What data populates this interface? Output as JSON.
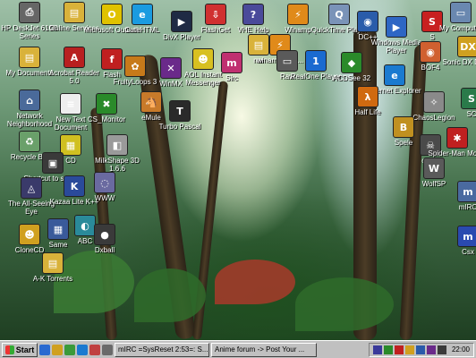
{
  "desktop_icons": [
    {
      "label": "HP DeskJet 610C Series",
      "glyph": "⎙",
      "color": "#666666",
      "icon": "printer-icon"
    },
    {
      "label": "Online Services",
      "glyph": "▤",
      "color": "#d9b23a",
      "icon": "folder-icon"
    },
    {
      "label": "Microsoft Outlook",
      "glyph": "O",
      "color": "#e0c200",
      "icon": "outlook-icon"
    },
    {
      "label": "CuteHTML",
      "glyph": "e",
      "color": "#1a9be0",
      "icon": "cutehtml-icon"
    },
    {
      "label": "DivX Player",
      "glyph": "▶",
      "color": "#1f2a44",
      "icon": "divx-player-icon"
    },
    {
      "label": "FlashGet",
      "glyph": "⇩",
      "color": "#d03030",
      "icon": "flashget-icon"
    },
    {
      "label": "VHE Help",
      "glyph": "?",
      "color": "#4a4a9a",
      "icon": "help-icon"
    },
    {
      "label": "Winamp",
      "glyph": "⚡",
      "color": "#e08a1a",
      "icon": "winamp-icon"
    },
    {
      "label": "QuickTime Player",
      "glyph": "Q",
      "color": "#7a93b8",
      "icon": "quicktime-icon"
    },
    {
      "label": "DC++",
      "glyph": "◉",
      "color": "#2a5caa",
      "icon": "dcpp-icon"
    },
    {
      "label": "Windows Media Player",
      "glyph": "▶",
      "color": "#2e66c4",
      "icon": "media-player-icon"
    },
    {
      "label": "S",
      "glyph": "S",
      "color": "#c82020",
      "icon": "s-icon"
    },
    {
      "label": "My Computer",
      "glyph": "▭",
      "color": "#6a88b0",
      "icon": "computer-icon"
    },
    {
      "label": "My Documents",
      "glyph": "▤",
      "color": "#d9b23a",
      "icon": "documents-icon"
    },
    {
      "label": "Acrobat Reader 5.0",
      "glyph": "A",
      "color": "#b82020",
      "icon": "acrobat-icon"
    },
    {
      "label": "Flash",
      "glyph": "f",
      "color": "#c02020",
      "icon": "flash-icon"
    },
    {
      "label": "FruityLoops 3",
      "glyph": "✿",
      "color": "#c77a1a",
      "icon": "fruityloops-icon"
    },
    {
      "label": "WinMX",
      "glyph": "✕",
      "color": "#6a2a8a",
      "icon": "winmx-icon"
    },
    {
      "label": "AOL Instant Messenger",
      "glyph": "☻",
      "color": "#d8c020",
      "icon": "aim-icon"
    },
    {
      "label": "Sirc",
      "glyph": "m",
      "color": "#c03070",
      "icon": "sirc-icon"
    },
    {
      "label": "nar",
      "glyph": "▤",
      "color": "#d9b23a",
      "icon": "folder-icon"
    },
    {
      "label": "winamp50be...",
      "glyph": "⚡",
      "color": "#e08a1a",
      "icon": "winamp-installer-icon"
    },
    {
      "label": "Raw",
      "glyph": "▭",
      "color": "#5a5a5a",
      "icon": "raw-icon"
    },
    {
      "label": "RealOne Player",
      "glyph": "1",
      "color": "#1a6ad0",
      "icon": "realone-icon"
    },
    {
      "label": "ACDSee 32",
      "glyph": "◆",
      "color": "#2a8a2a",
      "icon": "acdsee-icon"
    },
    {
      "label": "Internet Explorer",
      "glyph": "e",
      "color": "#1a7ad0",
      "icon": "ie-icon"
    },
    {
      "label": "BOF4",
      "glyph": "◉",
      "color": "#d06030",
      "icon": "bof4-icon"
    },
    {
      "label": "Sonic DX Demo",
      "glyph": "DX",
      "color": "#d0a020",
      "icon": "sonic-icon"
    },
    {
      "label": "Network Neighborhood",
      "glyph": "⌂",
      "color": "#4a6a9a",
      "icon": "network-icon"
    },
    {
      "label": "New Text Document",
      "glyph": "≡",
      "color": "#eeeeee",
      "icon": "text-document-icon"
    },
    {
      "label": "CS_Monitor",
      "glyph": "✖",
      "color": "#2a8a2a",
      "icon": "monitor-icon"
    },
    {
      "label": "eMule",
      "glyph": "🐴",
      "color": "#c87a2a",
      "icon": "emule-icon"
    },
    {
      "label": "Turbo Pascal",
      "glyph": "T",
      "color": "#2a2a2a",
      "icon": "turbo-pascal-icon"
    },
    {
      "label": "Half Life",
      "glyph": "λ",
      "color": "#d06a10",
      "icon": "half-life-icon"
    },
    {
      "label": "ChaosLegion",
      "glyph": "✧",
      "color": "#8a8a8a",
      "icon": "chaoslegion-icon"
    },
    {
      "label": "SC",
      "glyph": "S",
      "color": "#2a7a4a",
      "icon": "sc-icon"
    },
    {
      "label": "Recycle Bin",
      "glyph": "♻",
      "color": "#6aa06a",
      "icon": "recycle-bin-icon"
    },
    {
      "label": "CD",
      "glyph": "▦",
      "color": "#d0c020",
      "icon": "cd-icon"
    },
    {
      "label": "MilkShape 3D 1.6.6",
      "glyph": "◧",
      "color": "#9a9a9a",
      "icon": "milkshape-icon"
    },
    {
      "label": "Spele",
      "glyph": "B",
      "color": "#c09020",
      "icon": "spele-icon"
    },
    {
      "label": "czero",
      "glyph": "☠",
      "color": "#4a4a4a",
      "icon": "czero-icon"
    },
    {
      "label": "Spider-Man Movie",
      "glyph": "✱",
      "color": "#c02020",
      "icon": "spiderman-icon"
    },
    {
      "label": "Shortcut to stinger",
      "glyph": "▣",
      "color": "#3a3a3a",
      "icon": "stinger-icon"
    },
    {
      "label": "WolfSP",
      "glyph": "W",
      "color": "#5a5a5a",
      "icon": "wolfsp-icon"
    },
    {
      "label": "The All-Seeing Eye",
      "glyph": "◬",
      "color": "#3a3a6a",
      "icon": "all-seeing-eye-icon"
    },
    {
      "label": "Kazaa Lite K++",
      "glyph": "K",
      "color": "#2a4a9a",
      "icon": "kazaa-icon"
    },
    {
      "label": "WWW",
      "glyph": "◌",
      "color": "#6a6aa0",
      "icon": "www-icon"
    },
    {
      "label": "mIRC",
      "glyph": "m",
      "color": "#4a6aa0",
      "icon": "mirc-icon"
    },
    {
      "label": "CloneCD",
      "glyph": "☻",
      "color": "#d0a020",
      "icon": "clonecd-icon"
    },
    {
      "label": "Same",
      "glyph": "▦",
      "color": "#3a5a9a",
      "icon": "same-icon"
    },
    {
      "label": "ABC",
      "glyph": "◐",
      "color": "#2a8a9a",
      "icon": "abc-icon"
    },
    {
      "label": "Dxball",
      "glyph": "●",
      "color": "#3a3a3a",
      "icon": "dxball-icon"
    },
    {
      "label": "Csx",
      "glyph": "m",
      "color": "#2a4ab0",
      "icon": "csx-icon"
    },
    {
      "label": "A-K Torrents",
      "glyph": "▤",
      "color": "#d9b23a",
      "icon": "folder-icon"
    }
  ],
  "taskbar": {
    "start_label": "Start",
    "quick_launch": [
      "#2a6ad0",
      "#d0a020",
      "#3a9a3a",
      "#1a7ad0",
      "#c04040",
      "#6a6a6a"
    ],
    "tasks": [
      "mIRC =SysReset 2:53=: S...",
      "Anime forum -> Post Your ..."
    ],
    "tray_icons": [
      "#3a3a9a",
      "#2a8a2a",
      "#c02020",
      "#d0a020",
      "#2a5aaa",
      "#6a2a8a",
      "#3a3a3a"
    ],
    "clock": "22:00"
  }
}
